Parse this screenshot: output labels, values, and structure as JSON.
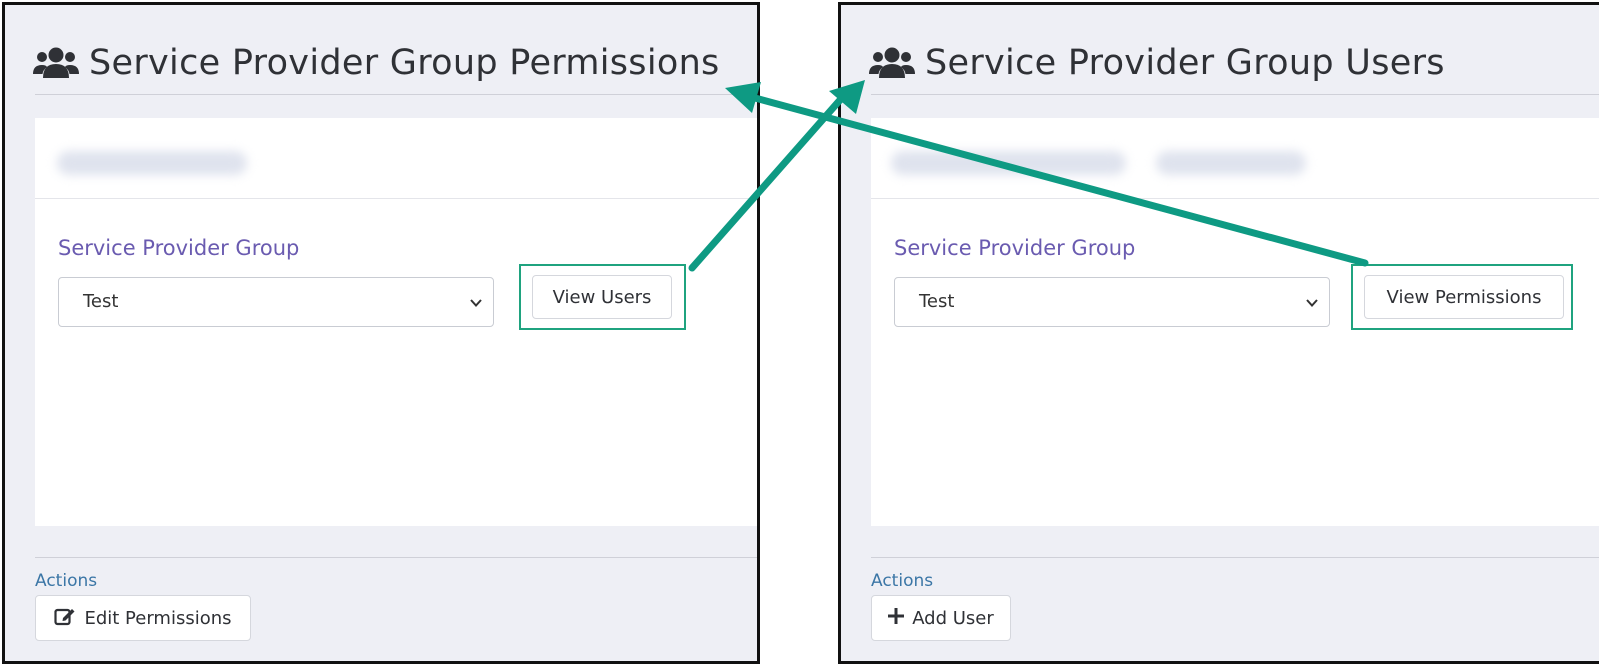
{
  "left_panel": {
    "title": "Service Provider Group Permissions",
    "title_icon": "users-icon",
    "field_label": "Service Provider Group",
    "select_value": "Test",
    "switch_button": "View Users",
    "actions_label": "Actions",
    "action_button": "Edit Permissions",
    "action_icon": "edit-icon"
  },
  "right_panel": {
    "title": "Service Provider Group Users",
    "title_icon": "users-icon",
    "field_label": "Service Provider Group",
    "select_value": "Test",
    "switch_button": "View Permissions",
    "actions_label": "Actions",
    "action_button": "Add User",
    "action_icon": "plus-icon"
  },
  "colors": {
    "highlight": "#1fa37f",
    "arrow": "#0e9a83",
    "label": "#6a5bb0",
    "actions": "#3b76a6"
  }
}
